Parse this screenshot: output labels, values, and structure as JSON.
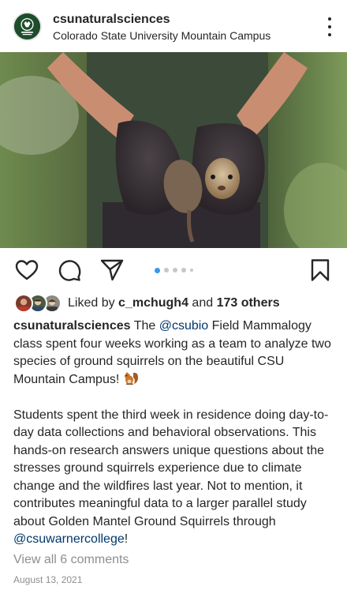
{
  "post": {
    "username": "csunaturalsciences",
    "location": "Colorado State University Mountain Campus",
    "avatar_icon": "csu-natural-sciences-logo",
    "photo_alt_icon": "hands-holding-ground-squirrel-photo"
  },
  "actions": {
    "like_icon": "heart-icon",
    "comment_icon": "comment-bubble-icon",
    "share_icon": "paper-plane-icon",
    "save_icon": "bookmark-icon",
    "carousel_total": 5,
    "carousel_active": 1
  },
  "likes": {
    "prefix": "Liked by ",
    "user": "c_mchugh4",
    "middle": " and ",
    "others": "173 others"
  },
  "caption": {
    "author": "csunaturalsciences",
    "p1_a": " The ",
    "mention1": "@csubio",
    "p1_b": " Field Mammalogy class spent four weeks working as a team to analyze two species of ground squirrels on the beautiful CSU Mountain Campus! ",
    "p2_a": "Students spent the third week in residence doing day-to-day data collections and behavioral observations. This hands-on research answers unique questions about the stresses ground squirrels experience due to climate change and the wildfires last year. Not to mention, it contributes meaningful data to a larger parallel study about Golden Mantel Ground Squirrels through ",
    "mention2": "@csuwarnercollege",
    "p2_b": "!"
  },
  "comments": {
    "label": "View all 6 comments"
  },
  "date": "August 13, 2021",
  "colors": {
    "mention": "#00376b",
    "muted": "#8e8e8e",
    "active_dot": "#3897f0",
    "logo_green": "#1e4d2b"
  }
}
